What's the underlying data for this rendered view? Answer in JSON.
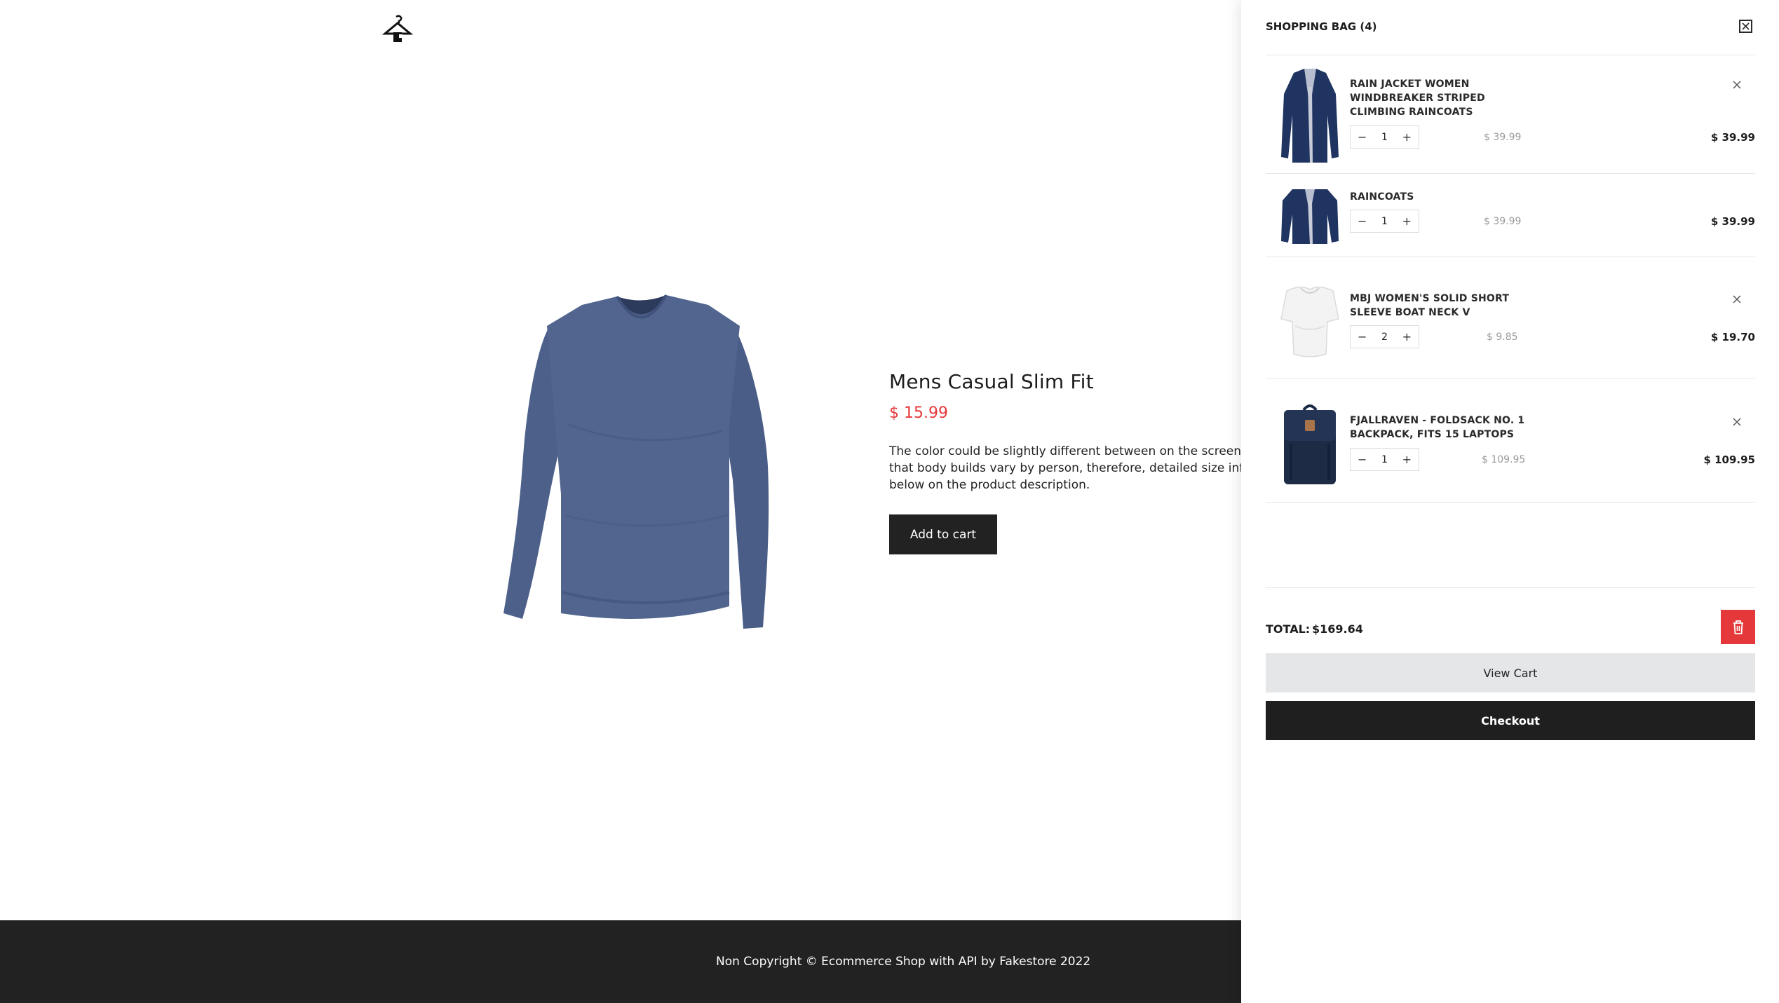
{
  "product": {
    "title": "Mens Casual Slim Fit",
    "price": "$ 15.99",
    "description": "The color could be slightly different between on the screen and that body builds vary by person, therefore, detailed size informo below on the product description.",
    "add_to_cart_label": "Add to cart"
  },
  "footer": {
    "text": "Non Copyright © Ecommerce Shop with API by Fakestore 2022"
  },
  "cart": {
    "title": "SHOPPING BAG (4)",
    "items": [
      {
        "name": "RAIN JACKET WOMEN WINDBREAKER STRIPED CLIMBING RAINCOATS",
        "quantity": "1",
        "unit_price": "$ 39.99",
        "total": "$ 39.99",
        "decrement": "−",
        "increment": "+"
      },
      {
        "name": "RAINCOATS",
        "quantity": "1",
        "unit_price": "$ 39.99",
        "total": "$ 39.99",
        "decrement": "−",
        "increment": "+"
      },
      {
        "name": "MBJ WOMEN'S SOLID SHORT SLEEVE BOAT NECK V",
        "quantity": "2",
        "unit_price": "$ 9.85",
        "total": "$ 19.70",
        "decrement": "−",
        "increment": "+"
      },
      {
        "name": "FJALLRAVEN - FOLDSACK NO. 1 BACKPACK, FITS 15 LAPTOPS",
        "quantity": "1",
        "unit_price": "$ 109.95",
        "total": "$ 109.95",
        "decrement": "−",
        "increment": "+"
      }
    ],
    "total_label": "TOTAL:",
    "total_value": "$169.64",
    "view_cart_label": "View Cart",
    "checkout_label": "Checkout"
  },
  "colors": {
    "accent_red": "#e5383b",
    "dark": "#222222",
    "light_button": "#e5e6e8"
  },
  "icons": [
    "hanger-logo-icon",
    "close-icon",
    "remove-icon",
    "trash-icon"
  ]
}
